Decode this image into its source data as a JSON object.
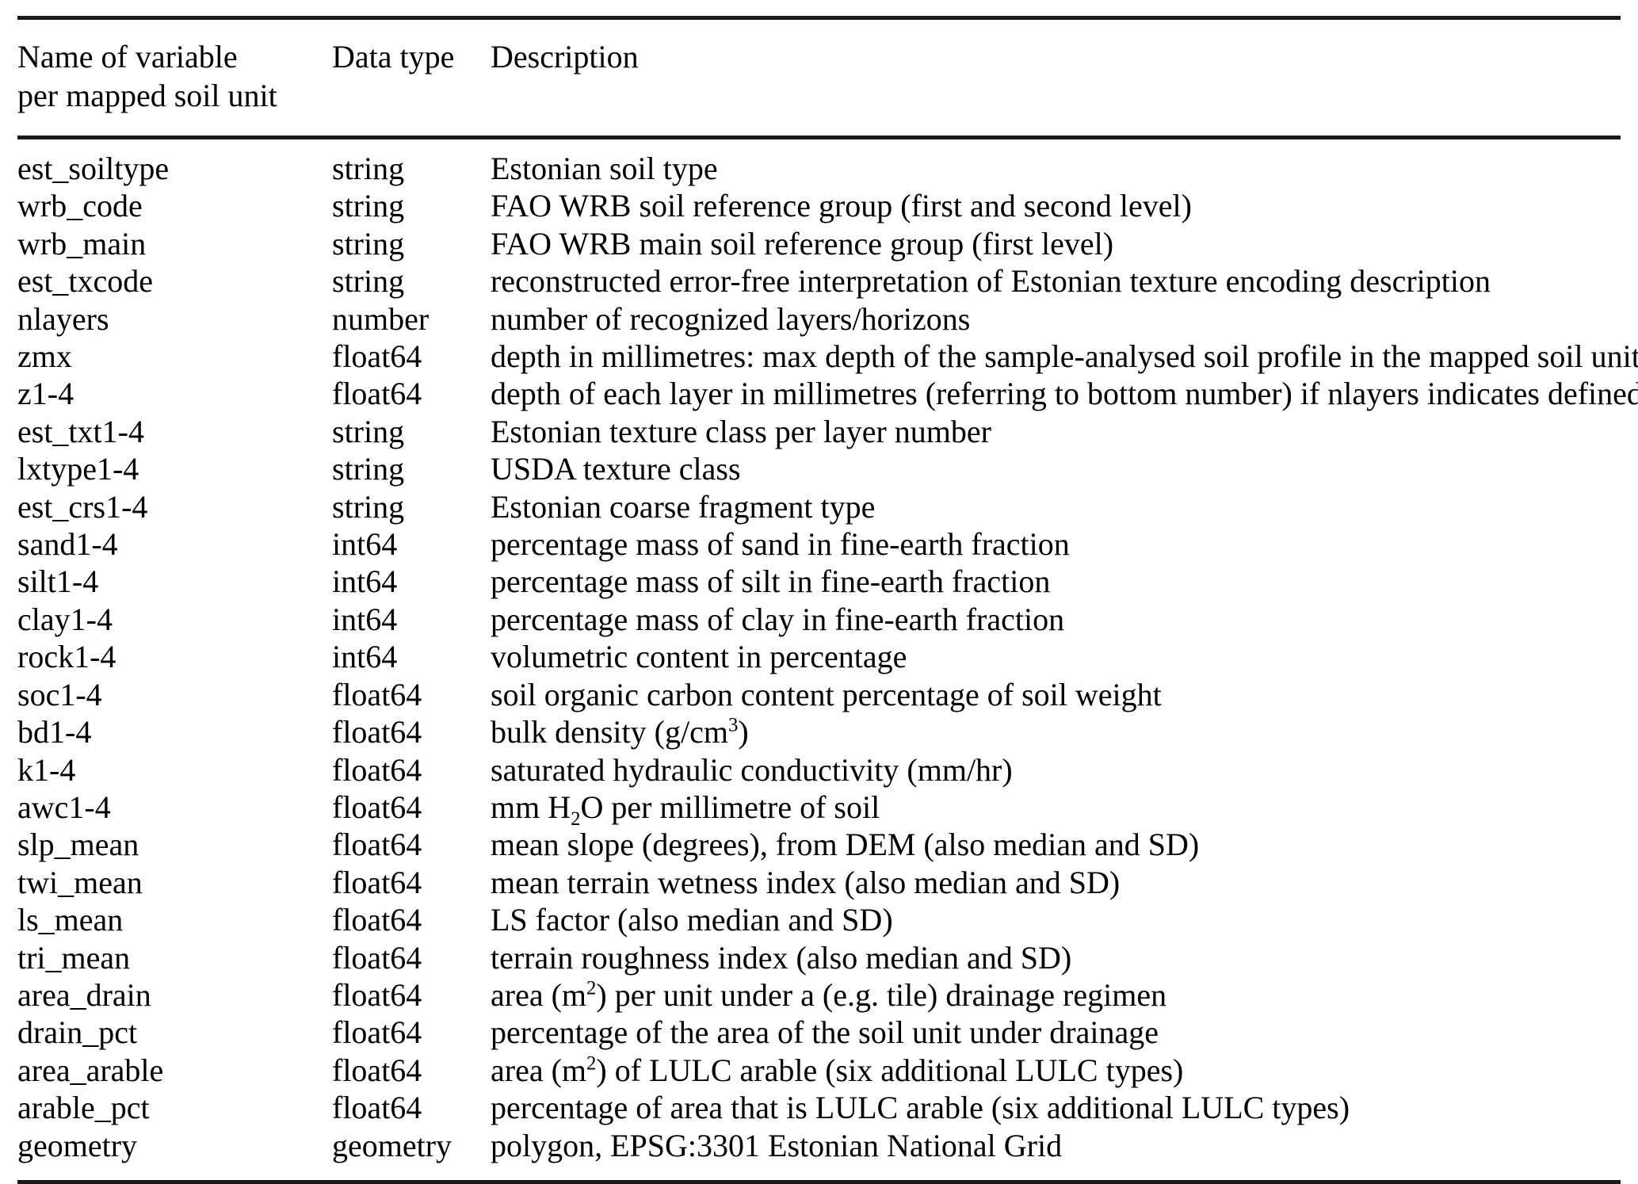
{
  "table": {
    "headers": {
      "name": [
        "Name of variable",
        "per mapped soil unit"
      ],
      "type": "Data type",
      "description": "Description"
    },
    "rows": [
      {
        "name": "est_soiltype",
        "type": "string",
        "description": "Estonian soil type"
      },
      {
        "name": "wrb_code",
        "type": "string",
        "description": "FAO WRB soil reference group (first and second level)"
      },
      {
        "name": "wrb_main",
        "type": "string",
        "description": "FAO WRB main soil reference group (first level)"
      },
      {
        "name": "est_txcode",
        "type": "string",
        "description": "reconstructed error-free interpretation of Estonian texture encoding description"
      },
      {
        "name": "nlayers",
        "type": "number",
        "description": "number of recognized layers/horizons"
      },
      {
        "name": "zmx",
        "type": "float64",
        "description": "depth in millimetres: max depth of the sample-analysed soil profile in the mapped soil unit"
      },
      {
        "name": "z1-4",
        "type": "float64",
        "description": "depth of each layer in millimetres (referring to bottom number) if nlayers indicates defined"
      },
      {
        "name": "est_txt1-4",
        "type": "string",
        "description": "Estonian texture class per layer number"
      },
      {
        "name": "lxtype1-4",
        "type": "string",
        "description": "USDA texture class"
      },
      {
        "name": "est_crs1-4",
        "type": "string",
        "description": "Estonian coarse fragment type"
      },
      {
        "name": "sand1-4",
        "type": "int64",
        "description": "percentage mass of sand in fine-earth fraction"
      },
      {
        "name": "silt1-4",
        "type": "int64",
        "description": "percentage mass of silt in fine-earth fraction"
      },
      {
        "name": "clay1-4",
        "type": "int64",
        "description": "percentage mass of clay in fine-earth fraction"
      },
      {
        "name": "rock1-4",
        "type": "int64",
        "description": "volumetric content in percentage"
      },
      {
        "name": "soc1-4",
        "type": "float64",
        "description": "soil organic carbon content percentage of soil weight"
      },
      {
        "name": "bd1-4",
        "type": "float64",
        "description_html": "bulk density (g/cm<sup>3</sup>)",
        "description": "bulk density (g/cm3)"
      },
      {
        "name": "k1-4",
        "type": "float64",
        "description": "saturated hydraulic conductivity (mm/hr)"
      },
      {
        "name": "awc1-4",
        "type": "float64",
        "description_html": "mm H<sub>2</sub>O per millimetre of soil",
        "description": "mm H2O per millimetre of soil"
      },
      {
        "name": "slp_mean",
        "type": "float64",
        "description": "mean slope (degrees), from DEM (also median and SD)"
      },
      {
        "name": "twi_mean",
        "type": "float64",
        "description": "mean terrain wetness index (also median and SD)"
      },
      {
        "name": "ls_mean",
        "type": "float64",
        "description": "LS factor (also median and SD)"
      },
      {
        "name": "tri_mean",
        "type": "float64",
        "description": "terrain roughness index (also median and SD)"
      },
      {
        "name": "area_drain",
        "type": "float64",
        "description_html": "area (m<sup>2</sup>) per unit under a (e.g. tile) drainage regimen",
        "description": "area (m2) per unit under a (e.g. tile) drainage regimen"
      },
      {
        "name": "drain_pct",
        "type": "float64",
        "description": "percentage of the area of the soil unit under drainage"
      },
      {
        "name": "area_arable",
        "type": "float64",
        "description_html": "area (m<sup>2</sup>) of LULC arable (six additional LULC types)",
        "description": "area (m2) of LULC arable (six additional LULC types)"
      },
      {
        "name": "arable_pct",
        "type": "float64",
        "description": "percentage of area that is LULC arable (six additional LULC types)"
      },
      {
        "name": "geometry",
        "type": "geometry",
        "description": "polygon, EPSG:3301 Estonian National Grid"
      }
    ]
  },
  "colors": {
    "rule": "#1a1a1a",
    "text": "#000000",
    "background": "#ffffff"
  }
}
